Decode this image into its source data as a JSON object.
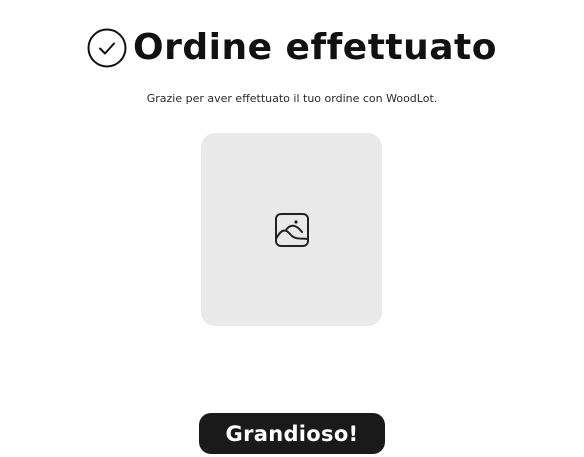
{
  "header": {
    "title": "Ordine effettuato",
    "icon": "check-circle-icon"
  },
  "message": {
    "text": "Grazie per aver effettuato il tuo ordine con WoodLot."
  },
  "image_placeholder": {
    "icon": "image-icon",
    "background": "#e9e9e9"
  },
  "actions": {
    "confirm_label": "Grandioso!",
    "confirm_color": "#1a1a1a"
  }
}
